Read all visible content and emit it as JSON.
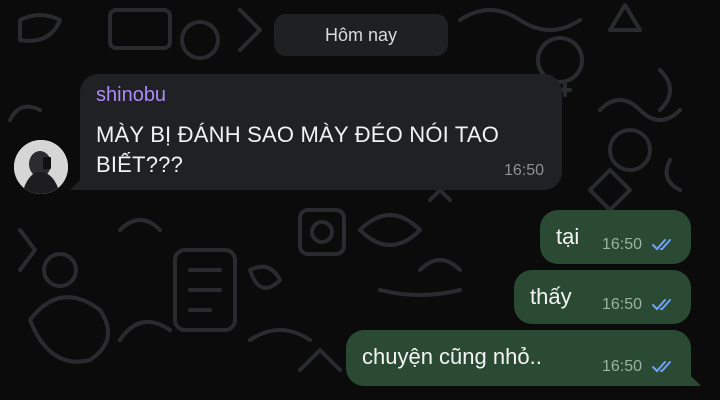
{
  "chat": {
    "date_separator": "Hôm nay",
    "incoming": {
      "sender": "shinobu",
      "text_line1": "MÀY BỊ ĐÁNH SAO MÀY ĐÉO NÓI TAO",
      "text_line2": "BIẾT???",
      "time": "16:50"
    },
    "outgoing": [
      {
        "text": "tại",
        "time": "16:50",
        "status": "read-double-check-icon"
      },
      {
        "text": "thấy",
        "time": "16:50",
        "status": "read-double-check-icon"
      },
      {
        "text": "chuyện cũng nhỏ..",
        "time": "16:50",
        "status": "read-double-check-icon"
      }
    ]
  },
  "colors": {
    "background": "#0b0b0c",
    "incoming_bubble": "#202124",
    "outgoing_bubble": "#2a4a33",
    "sender_name": "#a98cf6",
    "read_check": "#6fa3ff"
  }
}
